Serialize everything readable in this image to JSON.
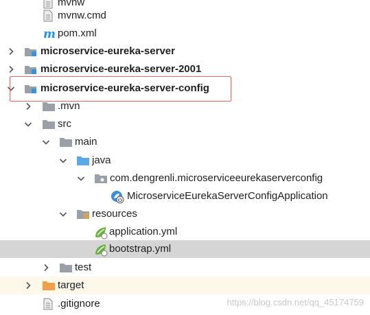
{
  "project_tree": {
    "items": [
      {
        "label": "mvnw",
        "icon": "file-icon"
      },
      {
        "label": "mvnw.cmd",
        "icon": "file-icon"
      },
      {
        "label": "pom.xml",
        "icon": "maven-icon"
      },
      {
        "label": "microservice-eureka-server",
        "icon": "module-icon",
        "expanded": false
      },
      {
        "label": "microservice-eureka-server-2001",
        "icon": "module-icon",
        "expanded": false
      },
      {
        "label": "microservice-eureka-server-config",
        "icon": "module-icon",
        "expanded": true,
        "highlighted": true
      },
      {
        "label": ".mvn",
        "icon": "folder-icon",
        "expanded": false
      },
      {
        "label": "src",
        "icon": "folder-icon",
        "expanded": true
      },
      {
        "label": "main",
        "icon": "folder-icon",
        "expanded": true
      },
      {
        "label": "java",
        "icon": "source-folder-icon",
        "expanded": true
      },
      {
        "label": "com.dengrenli.microserviceeurekaserverconfig",
        "icon": "package-icon",
        "expanded": true
      },
      {
        "label": "MicroserviceEurekaServerConfigApplication",
        "icon": "spring-boot-class-icon"
      },
      {
        "label": "resources",
        "icon": "resources-folder-icon",
        "expanded": true
      },
      {
        "label": "application.yml",
        "icon": "spring-yml-icon"
      },
      {
        "label": "bootstrap.yml",
        "icon": "spring-yml-icon",
        "selected": true
      },
      {
        "label": "test",
        "icon": "folder-icon",
        "expanded": false
      },
      {
        "label": "target",
        "icon": "excluded-folder-icon",
        "expanded": false
      },
      {
        "label": ".gitignore",
        "icon": "file-icon"
      }
    ]
  },
  "watermark": "https://blog.csdn.net/qq_45174759",
  "colors": {
    "highlight_border": "#e06a6a",
    "selected_row": "#d5d5d5",
    "excluded_row": "#fdf8ea",
    "source_folder": "#5aa9e6",
    "excluded_folder": "#f0a04b",
    "spring_green": "#6db33f",
    "maven_blue": "#1e90ff"
  }
}
